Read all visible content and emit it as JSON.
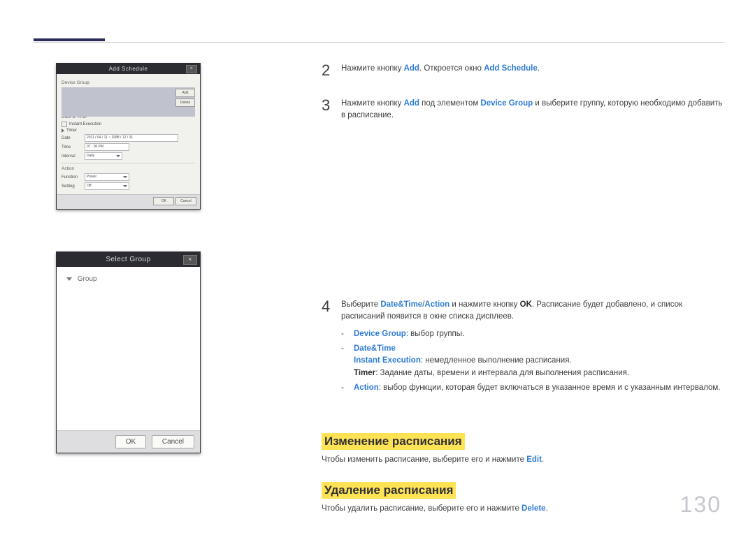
{
  "page_number": "130",
  "dlg_add": {
    "title": "Add Schedule",
    "sections": {
      "device_group": "Device Group",
      "date_time": "Date & Time",
      "action": "Action"
    },
    "buttons": {
      "add": "Add",
      "delete": "Delete"
    },
    "instant": "Instant Execution",
    "timer_label": "Timer",
    "rows": {
      "date": "Date",
      "date_val": "2011 / 04 / 11  ~  2088 / 12 / 31",
      "time": "Time",
      "time_val": "07 : 00   PM",
      "interval": "Interval",
      "interval_val": "Daily",
      "function": "Function",
      "function_val": "Power",
      "setting": "Setting",
      "setting_val": "Off"
    },
    "footer": {
      "ok": "OK",
      "cancel": "Cancel"
    }
  },
  "dlg_select": {
    "title": "Select Group",
    "tree_root": "Group",
    "footer": {
      "ok": "OK",
      "cancel": "Cancel"
    }
  },
  "steps": {
    "s2": {
      "num": "2",
      "pre": "Нажмите кнопку ",
      "kw1": "Add",
      "mid": ". Откроется окно ",
      "kw2": "Add Schedule",
      "post": "."
    },
    "s3": {
      "num": "3",
      "pre": "Нажмите кнопку ",
      "kw1": "Add",
      "mid1": " под элементом ",
      "kw2": "Device Group",
      "post": " и выберите группу, которую необходимо добавить в расписание."
    },
    "s4": {
      "num": "4",
      "pre": "Выберите ",
      "kw1": "Date&Time",
      "slash": "/",
      "kw2": "Action",
      "mid1": " и нажмите кнопку ",
      "b1": "OK",
      "post": ". Расписание будет добавлено, и список расписаний появится в окне списка дисплеев."
    }
  },
  "sub": {
    "dg_label": "Device Group",
    "dg_text": ": выбор группы.",
    "dt_label": "Date&Time",
    "ie_label": "Instant Execution",
    "ie_text": ": немедленное выполнение расписания.",
    "tm_label": "Timer",
    "tm_text": ": Задание даты, времени и интервала для выполнения расписания.",
    "ac_label": "Action",
    "ac_text": ": выбор функции, которая будет включаться в указанное время и с указанным интервалом."
  },
  "headings": {
    "edit": "Изменение расписания",
    "delete": "Удаление расписания"
  },
  "paras": {
    "edit_pre": "Чтобы изменить расписание, выберите его и нажмите ",
    "edit_kw": "Edit",
    "edit_post": ".",
    "del_pre": "Чтобы удалить расписание, выберите его и нажмите ",
    "del_kw": "Delete",
    "del_post": "."
  }
}
